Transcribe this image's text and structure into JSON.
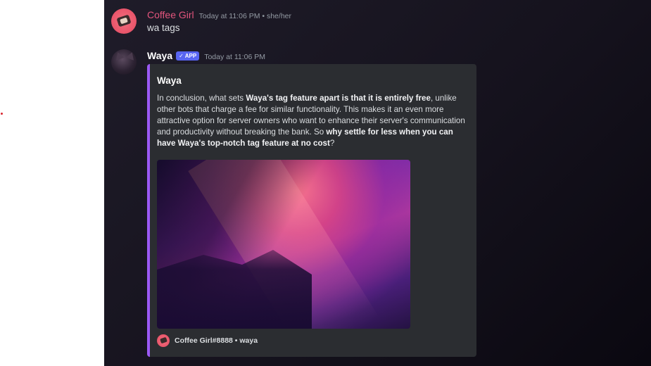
{
  "messages": [
    {
      "author": "Coffee Girl",
      "timestamp": "Today at 11:06 PM",
      "pronouns": "she/her",
      "content": "wa tags"
    },
    {
      "author": "Waya",
      "badge": "APP",
      "badge_check": "✓",
      "timestamp": "Today at 11:06 PM",
      "embed": {
        "title": "Waya",
        "description_parts": [
          "In conclusion, what sets ",
          "Waya's tag feature apart is that it is entirely free",
          ", unlike other bots that charge a fee for similar functionality. This makes it an even more attractive option for server owners who want to enhance their server's communication and productivity without breaking the bank. So ",
          "why settle for less when you can have Waya's top-notch tag feature at no cost",
          "?"
        ],
        "footer": "Coffee Girl#8888 • waya",
        "image_alt": "",
        "accent_color": "#9b59f6"
      }
    }
  ],
  "colors": {
    "coffee_name": "#e3557d",
    "badge": "#5865f2",
    "embed_bg": "#2b2d31"
  }
}
